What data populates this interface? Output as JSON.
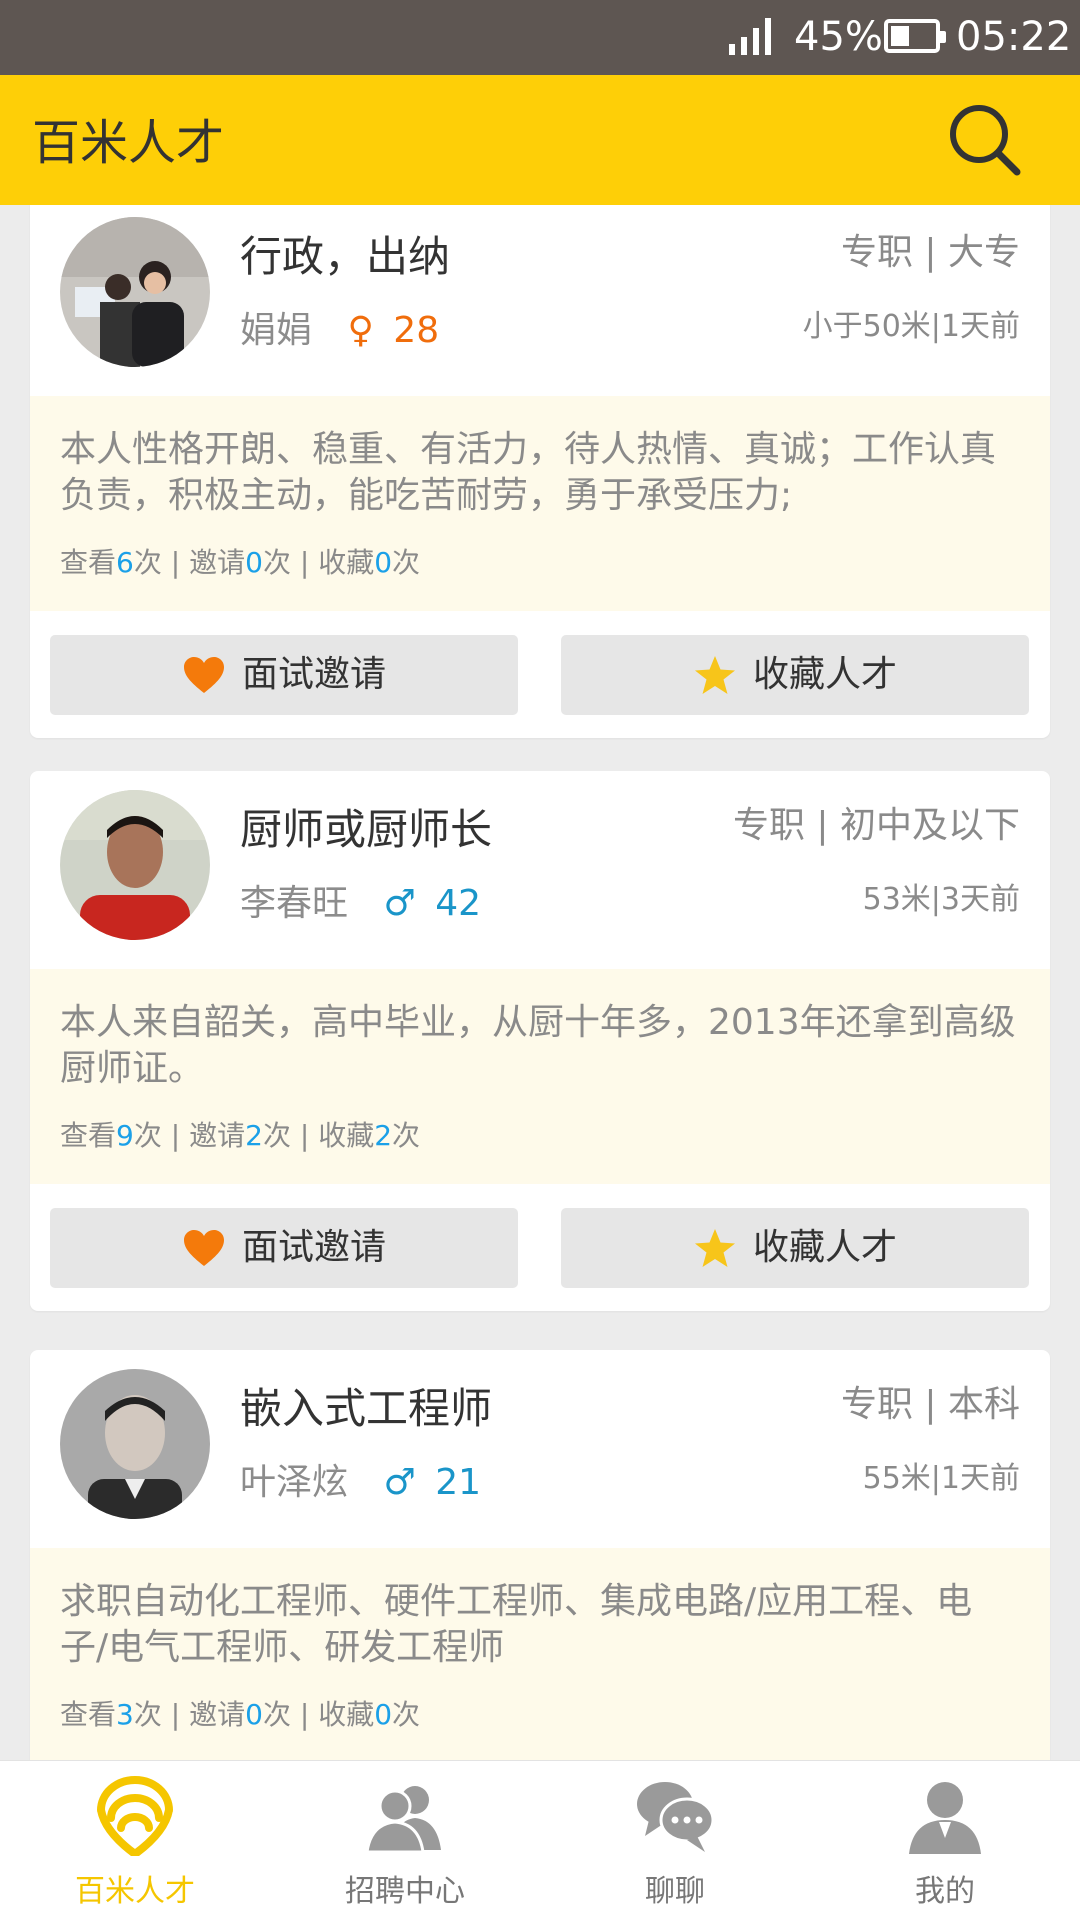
{
  "status_bar": {
    "battery": "45%",
    "time": "05:22"
  },
  "app_bar": {
    "title": "百米人才",
    "search_icon": "search-icon"
  },
  "accent_color": "#fecf07",
  "candidates": [
    {
      "job": "行政，出纳",
      "name": "娟娟",
      "gender_symbol": "♀",
      "gender": "female",
      "age": "28",
      "employment": "专职",
      "education": "大专",
      "distance": "小于50米",
      "time": "1天前",
      "bio": "本人性格开朗、稳重、有活力，待人热情、真诚；工作认真负责，积极主动，能吃苦耐劳，勇于承受压力;",
      "stats": {
        "view_label": "查看",
        "views": "6",
        "invite_label": "邀请",
        "invites": "0",
        "collect_label": "收藏",
        "collects": "0",
        "unit": "次"
      }
    },
    {
      "job": "厨师或厨师长",
      "name": "李春旺",
      "gender_symbol": "♂",
      "gender": "male",
      "age": "42",
      "employment": "专职",
      "education": "初中及以下",
      "distance": "53米",
      "time": "3天前",
      "bio": "本人来自韶关，高中毕业，从厨十年多，2013年还拿到高级厨师证。",
      "stats": {
        "view_label": "查看",
        "views": "9",
        "invite_label": "邀请",
        "invites": "2",
        "collect_label": "收藏",
        "collects": "2",
        "unit": "次"
      }
    },
    {
      "job": "嵌入式工程师",
      "name": "叶泽炫",
      "gender_symbol": "♂",
      "gender": "male",
      "age": "21",
      "employment": "专职",
      "education": "本科",
      "distance": "55米",
      "time": "1天前",
      "bio": "求职自动化工程师、硬件工程师、集成电路/应用工程、电子/电气工程师、研发工程师",
      "stats": {
        "view_label": "查看",
        "views": "3",
        "invite_label": "邀请",
        "invites": "0",
        "collect_label": "收藏",
        "collects": "0",
        "unit": "次"
      }
    }
  ],
  "buttons": {
    "invite": "面试邀请",
    "collect": "收藏人才"
  },
  "tabs": [
    {
      "label": "百米人才",
      "icon": "radar-icon",
      "active": true
    },
    {
      "label": "招聘中心",
      "icon": "people-icon",
      "active": false
    },
    {
      "label": "聊聊",
      "icon": "chat-icon",
      "active": false
    },
    {
      "label": "我的",
      "icon": "person-icon",
      "active": false
    }
  ]
}
